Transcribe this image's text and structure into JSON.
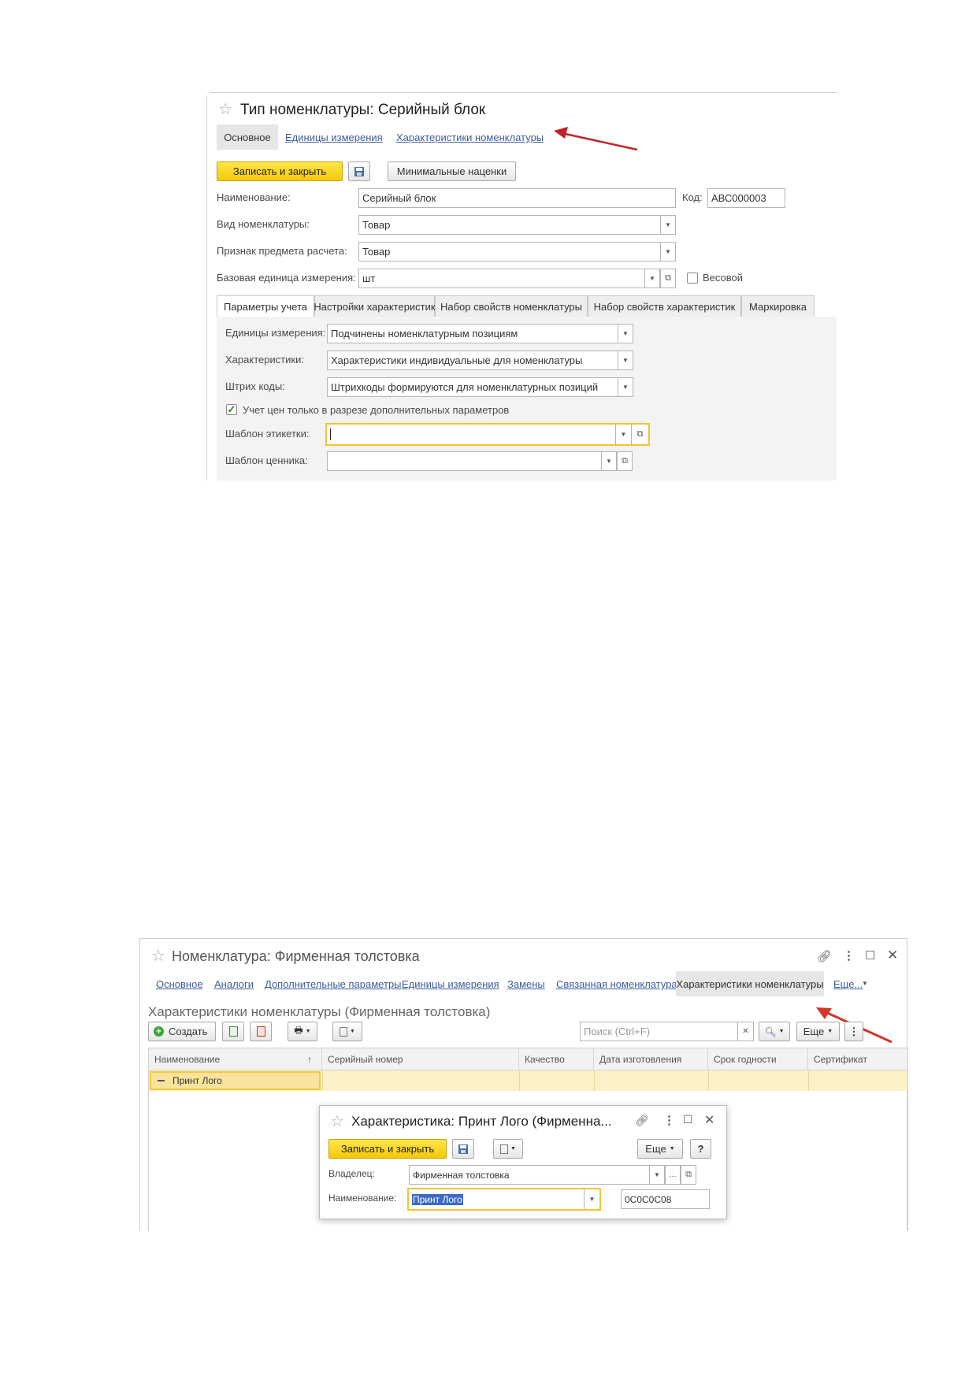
{
  "form1": {
    "title": "Тип номенклатуры: Серийный блок",
    "nav": {
      "main": "Основное",
      "units": "Единицы измерения",
      "chars": "Характеристики номенклатуры"
    },
    "toolbar": {
      "save_close": "Записать и закрыть",
      "min_markups": "Минимальные наценки"
    },
    "fields": {
      "name_label": "Наименование:",
      "name_value": "Серийный блок",
      "code_label": "Код:",
      "code_value": "АВС000003",
      "kind_label": "Вид номенклатуры:",
      "kind_value": "Товар",
      "calc_label": "Признак предмета расчета:",
      "calc_value": "Товар",
      "unit_label": "Базовая единица измерения:",
      "unit_value": "шт",
      "weight_label": "Весовой"
    },
    "tabs": [
      "Параметры учета",
      "Настройки характеристик",
      "Набор свойств номенклатуры",
      "Набор свойств характеристик",
      "Маркировка"
    ],
    "panel": {
      "units_label": "Единицы измерения:",
      "units_value": "Подчинены номенклатурным позициям",
      "chars_label": "Характеристики:",
      "chars_value": "Характеристики индивидуальные для номенклатуры",
      "barcodes_label": "Штрих коды:",
      "barcodes_value": "Штрихкоды формируются для номенклатурных позиций",
      "price_check_label": "Учет цен только в разрезе дополнительных параметров",
      "label_template_label": "Шаблон этикетки:",
      "label_template_value": "",
      "price_tag_label": "Шаблон ценника:",
      "price_tag_value": ""
    }
  },
  "form2": {
    "title": "Номенклатура: Фирменная толстовка",
    "nav": [
      "Основное",
      "Аналоги",
      "Дополнительные параметры",
      "Единицы измерения",
      "Замены",
      "Связанная номенклатура",
      "Характеристики номенклатуры",
      "Еще..."
    ],
    "subtitle": "Характеристики номенклатуры (Фирменная толстовка)",
    "toolbar": {
      "create": "Создать",
      "search_placeholder": "Поиск (Ctrl+F)",
      "more": "Еще"
    },
    "columns": [
      "Наименование",
      "Серийный номер",
      "Качество",
      "Дата изготовления",
      "Срок годности",
      "Сертификат"
    ],
    "rows": [
      {
        "name": "Принт Лого"
      }
    ]
  },
  "form3": {
    "title": "Характеристика: Принт Лого (Фирменна...",
    "save_close": "Записать и закрыть",
    "more": "Еще",
    "help": "?",
    "owner_label": "Владелец:",
    "owner_value": "Фирменная толстовка",
    "name_label": "Наименование:",
    "name_value": "Принт Лого",
    "code_value": "0С0С0С08"
  }
}
